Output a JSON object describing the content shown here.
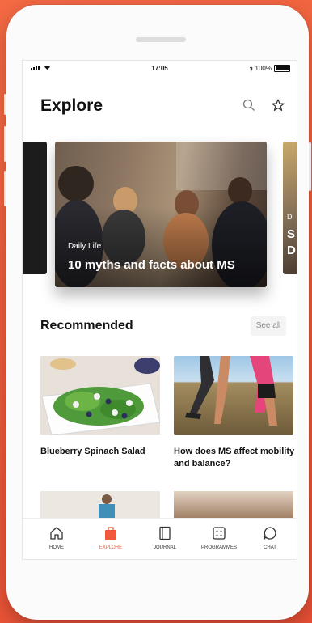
{
  "status_bar": {
    "time": "17:05",
    "battery": "100%"
  },
  "header": {
    "title": "Explore",
    "search_icon": "search-icon",
    "favorite_icon": "star-icon"
  },
  "hero": {
    "category": "Daily Life",
    "title": "10 myths and facts about MS",
    "peek_letters": [
      "D",
      "S",
      "D"
    ]
  },
  "recommended": {
    "title": "Recommended",
    "see_all": "See all",
    "cards": [
      {
        "title": "Blueberry Spinach Salad"
      },
      {
        "title": "How does MS affect mobility and balance?"
      }
    ]
  },
  "tabs": [
    {
      "label": "HOME",
      "icon": "home-icon",
      "active": false
    },
    {
      "label": "EXPLORE",
      "icon": "explore-icon",
      "active": true
    },
    {
      "label": "JOURNAL",
      "icon": "journal-icon",
      "active": false
    },
    {
      "label": "PROGRAMMES",
      "icon": "programmes-icon",
      "active": false
    },
    {
      "label": "CHAT",
      "icon": "chat-icon",
      "active": false
    }
  ],
  "colors": {
    "accent": "#f05a3a",
    "background": "#ee5a3a"
  }
}
